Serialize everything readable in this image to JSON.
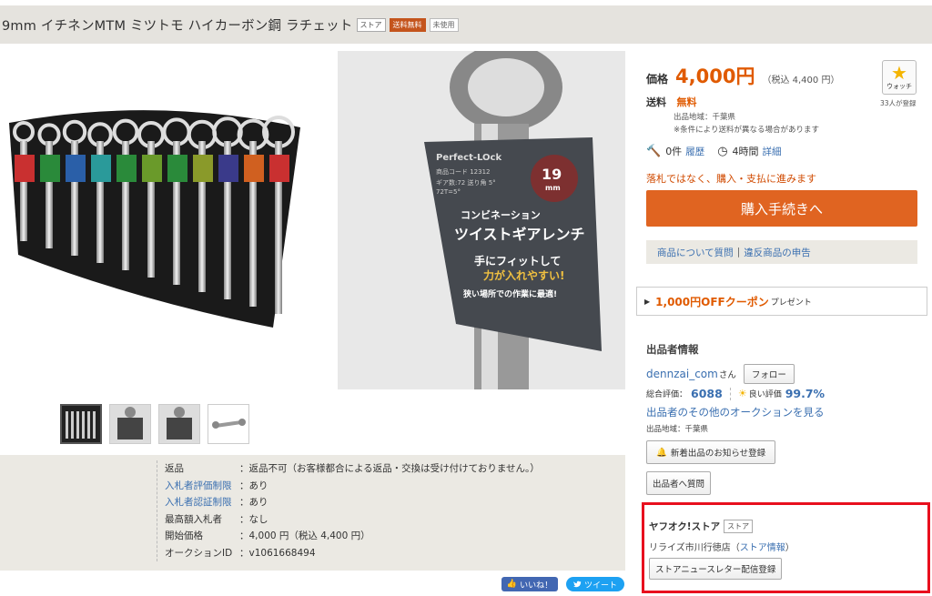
{
  "title": {
    "text": "9mm イチネンMTM ミツトモ ハイカーボン鋼 ラチェット",
    "badge_store": "ストア",
    "badge_shipping": "送料無料",
    "badge_condition": "未使用"
  },
  "product_image": {
    "label_brand": "Perfect-LOck",
    "label_code": "商品コード 12312",
    "label_gear": "ギア数:72 送り角 5°",
    "label_spec": "72T=5°",
    "label_size": "19",
    "label_unit": "mm",
    "label_line1": "コンビネーション",
    "label_line2": "ツイストギアレンチ",
    "label_line3": "手にフィットして",
    "label_line4": "力が入れやすい!",
    "label_line5": "狭い場所での作業に最適!"
  },
  "details": {
    "rows": [
      {
        "label": "返品",
        "value": "：返品不可（お客様都合による返品・交換は受け付けておりません。）",
        "link": false
      },
      {
        "label": "入札者評価制限",
        "value": "：あり",
        "link": true
      },
      {
        "label": "入札者認証制限",
        "value": "：あり",
        "link": true
      },
      {
        "label": "最高額入札者",
        "value": "：なし",
        "link": false
      },
      {
        "label": "開始価格",
        "value": "：4,000 円（税込 4,400 円）",
        "link": false
      },
      {
        "label": "オークションID",
        "value": "：v1061668494",
        "link": false
      }
    ]
  },
  "social": {
    "like": "いいね！",
    "tweet": "ツイート"
  },
  "price": {
    "label": "価格",
    "value": "4,000円",
    "tax": "（税込 4,400 円）"
  },
  "watch": {
    "label": "ウォッチ",
    "count": "33人が登録"
  },
  "shipping": {
    "label": "送料",
    "value": "無料",
    "region": "出品地域：千葉県",
    "note": "※条件により送料が異なる場合があります"
  },
  "bids": {
    "count": "0件",
    "history": "履歴",
    "time": "4時間",
    "detail": "詳細"
  },
  "notice": "落札ではなく、購入・支払に進みます",
  "buy_button": "購入手続きへ",
  "questions": {
    "ask": "商品について質問",
    "sep": "|",
    "report": "違反商品の申告"
  },
  "coupon": {
    "value": "1,000円OFFクーポン",
    "suffix": "プレゼント"
  },
  "seller": {
    "heading": "出品者情報",
    "name": "dennzai_com",
    "san": "さん",
    "follow": "フォロー",
    "total_label": "総合評価：",
    "total_value": "6088",
    "good_label": "良い評価",
    "good_value": "99.7%",
    "others": "出品者のその他のオークションを見る",
    "region": "出品地域：千葉県",
    "new_notify": "新着出品のお知らせ登録",
    "ask": "出品者へ質問"
  },
  "store": {
    "title": "ヤフオク!ストア",
    "badge": "ストア",
    "name": "リライズ市川行徳店",
    "info_open": "（",
    "info_link": "ストア情報",
    "info_close": "）",
    "newsletter": "ストアニュースレター配信登録"
  },
  "icons": {
    "next": "chevron-right-icon",
    "watch": "star-icon",
    "bid": "gavel-icon",
    "clock": "clock-icon",
    "good": "sun-icon",
    "like": "thumbs-up-icon",
    "tweet": "twitter-bird-icon"
  }
}
